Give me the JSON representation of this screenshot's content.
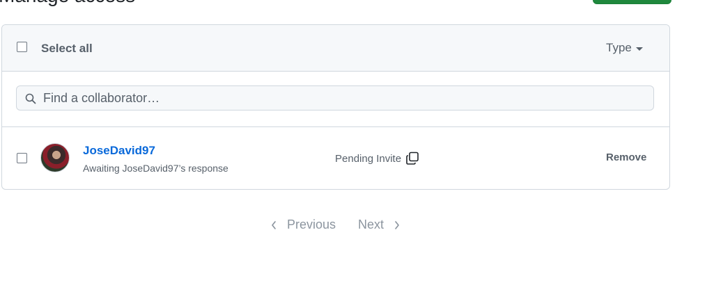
{
  "page": {
    "title": "Manage access"
  },
  "header": {
    "select_all_label": "Select all",
    "type_filter_label": "Type"
  },
  "search": {
    "placeholder": "Find a collaborator…"
  },
  "collaborators": [
    {
      "username": "JoseDavid97",
      "status_text": "Awaiting JoseDavid97’s response",
      "role_status": "Pending Invite",
      "remove_label": "Remove"
    }
  ],
  "pagination": {
    "previous_label": "Previous",
    "next_label": "Next"
  },
  "colors": {
    "accent": "#0969da",
    "primary_button": "#1f883d",
    "muted_text": "#57606a",
    "border": "#d0d7de"
  }
}
